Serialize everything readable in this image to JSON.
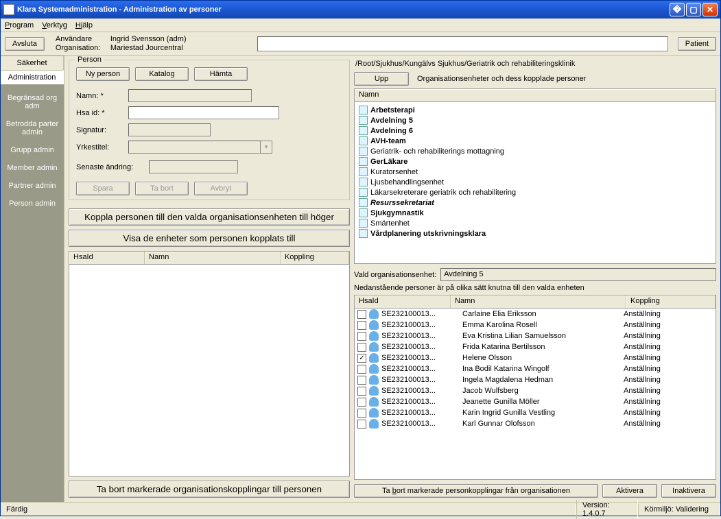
{
  "title": "Klara Systemadministration - Administration av personer",
  "menu": {
    "program": "Program",
    "verktyg": "Verktyg",
    "hjalp": "Hjälp"
  },
  "avsluta": "Avsluta",
  "id": {
    "user_label": "Användare",
    "user_value": "Ingrid Svensson (adm)",
    "org_label": "Organisation:",
    "org_value": "Mariestad Jourcentral"
  },
  "patient_btn": "Patient",
  "nav": {
    "tab_sakerhet": "Säkerhet",
    "tab_admin": "Administration",
    "begransad": "Begränsad org adm",
    "betrodda": "Betrodda parter admin",
    "grupp": "Grupp admin",
    "member": "Member admin",
    "partner": "Partner admin",
    "person": "Person admin"
  },
  "person_group": {
    "label": "Person",
    "ny": "Ny person",
    "katalog": "Katalog",
    "hamta": "Hämta",
    "namn": "Namn: *",
    "hsa": "Hsa id: *",
    "signatur": "Signatur:",
    "yrkestitel": "Yrkestitel:",
    "senaste": "Senaste ändring:",
    "spara": "Spara",
    "tabort": "Ta bort",
    "avbryt": "Avbryt"
  },
  "koppla_btn": "Koppla personen till den valda organisationsenheten till höger",
  "visa_btn": "Visa de enheter som personen kopplats till",
  "left_hdr": {
    "c1": "HsaId",
    "c2": "Namn",
    "c3": "Koppling"
  },
  "left_remove": "Ta bort markerade organisationskopplingar till personen",
  "breadcrumb": "/Root/Sjukhus/Kungälvs Sjukhus/Geriatrik och rehabiliteringsklinik",
  "upp": "Upp",
  "tree_desc": "Organisationsenheter och dess kopplade personer",
  "tree_hdr": "Namn",
  "tree": [
    {
      "text": "Arbetsterapi",
      "style": "bold"
    },
    {
      "text": "Avdelning 5",
      "style": "bold"
    },
    {
      "text": "Avdelning 6",
      "style": "bold"
    },
    {
      "text": "AVH-team",
      "style": "bold"
    },
    {
      "text": "Geriatrik- och rehabiliterings mottagning",
      "style": ""
    },
    {
      "text": "GerLäkare",
      "style": "bold"
    },
    {
      "text": "Kuratorsenhet",
      "style": ""
    },
    {
      "text": "Ljusbehandlingsenhet",
      "style": ""
    },
    {
      "text": "Läkarsekreterare geriatrik och rehabilitering",
      "style": ""
    },
    {
      "text": "Resurssekretariat",
      "style": "bold italic"
    },
    {
      "text": "Sjukgymnastik",
      "style": "bold"
    },
    {
      "text": "Smärtenhet",
      "style": ""
    },
    {
      "text": "Vårdplanering utskrivningsklara",
      "style": "bold"
    }
  ],
  "selunit_label": "Vald organisationsenhet:",
  "selunit_value": "Avdelning 5",
  "pl_desc": "Nedanstående personer är på olika sätt knutna  till den valda enheten",
  "pl_hdr": {
    "c1": "HsaId",
    "c2": "Namn",
    "c3": "Koppling"
  },
  "persons": [
    {
      "chk": false,
      "hsa": "SE232100013...",
      "namn": "Carlaine Elia Eriksson",
      "kop": "Anställning"
    },
    {
      "chk": false,
      "hsa": "SE232100013...",
      "namn": "Emma Karolina Rosell",
      "kop": "Anställning"
    },
    {
      "chk": false,
      "hsa": "SE232100013...",
      "namn": "Eva Kristina Lilian Samuelsson",
      "kop": "Anställning"
    },
    {
      "chk": false,
      "hsa": "SE232100013...",
      "namn": "Frida Katarina Bertilsson",
      "kop": "Anställning"
    },
    {
      "chk": true,
      "hsa": "SE232100013...",
      "namn": "Helene Olsson",
      "kop": "Anställning"
    },
    {
      "chk": false,
      "hsa": "SE232100013...",
      "namn": "Ina Bodil Katarina Wingolf",
      "kop": "Anställning"
    },
    {
      "chk": false,
      "hsa": "SE232100013...",
      "namn": "Ingela Magdalena Hedman",
      "kop": "Anställning"
    },
    {
      "chk": false,
      "hsa": "SE232100013...",
      "namn": "Jacob Wulfsberg",
      "kop": "Anställning"
    },
    {
      "chk": false,
      "hsa": "SE232100013...",
      "namn": "Jeanette Gunilla Möller",
      "kop": "Anställning"
    },
    {
      "chk": false,
      "hsa": "SE232100013...",
      "namn": "Karin Ingrid Gunilla Vestling",
      "kop": "Anställning"
    },
    {
      "chk": false,
      "hsa": "SE232100013...",
      "namn": "Karl Gunnar Olofsson",
      "kop": "Anställning"
    }
  ],
  "right_remove": "Ta bort markerade personkopplingar från organisationen",
  "aktivera": "Aktivera",
  "inaktivera": "Inaktivera",
  "status": {
    "fardig": "Färdig",
    "version": "Version: 1.4.0.7",
    "miljo": "Körmiljö: Validering"
  }
}
